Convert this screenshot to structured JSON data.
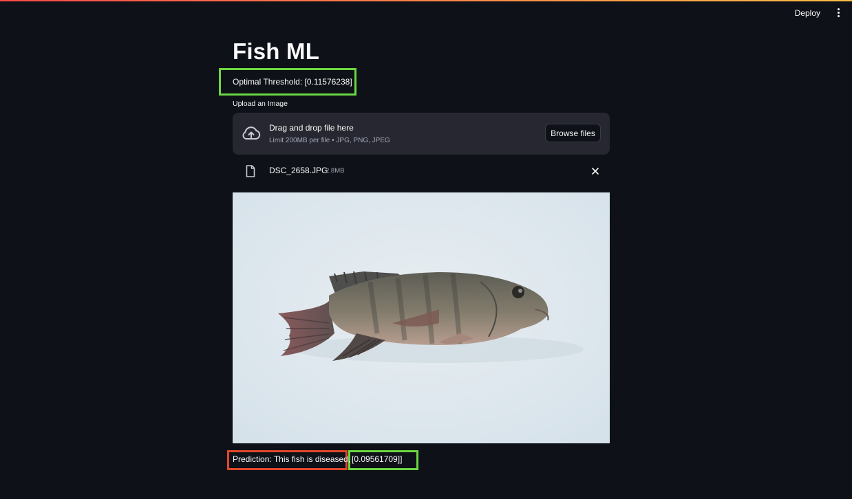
{
  "header": {
    "deploy_label": "Deploy",
    "menu_icon": "kebab-menu-icon"
  },
  "page": {
    "title": "Fish ML",
    "threshold": "Optimal Threshold: [0.11576238]"
  },
  "uploader": {
    "label": "Upload an Image",
    "drag_text": "Drag and drop file here",
    "limit_text": "Limit 200MB per file • JPG, PNG, JPEG",
    "browse_label": "Browse files",
    "upload_icon": "cloud-upload-icon"
  },
  "uploaded_file": {
    "name": "DSC_2658.JPG",
    "size": "2.8MB",
    "icon": "file-icon"
  },
  "prediction": {
    "text": "Prediction: This fish is diseased,",
    "value": "[0.09561709]]"
  },
  "colors": {
    "background": "#0e1117",
    "panel": "#262730",
    "highlight_green": "#6bd742",
    "highlight_red": "#e2472b"
  }
}
